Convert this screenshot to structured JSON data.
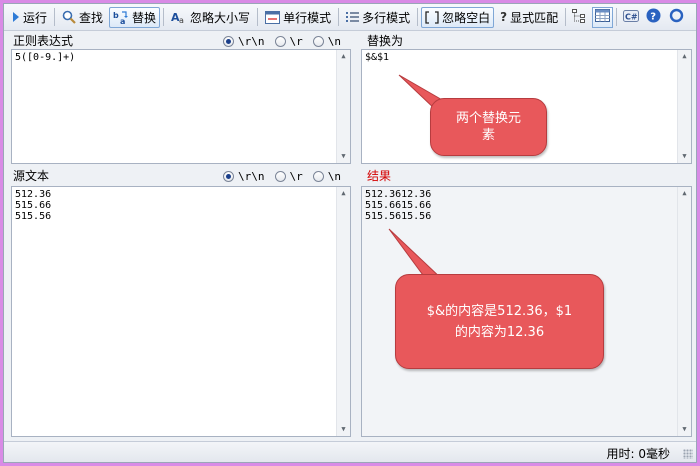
{
  "toolbar": {
    "run_label": "运行",
    "find_label": "查找",
    "replace_label": "替换",
    "ignore_case_label": "忽略大小写",
    "single_line_label": "单行模式",
    "multi_line_label": "多行模式",
    "ignore_space_label": "忽略空白",
    "explicit_capture_label": "显式匹配",
    "explicit_capture_mark": "?"
  },
  "regex_panel": {
    "label": "正则表达式",
    "value": "5([0-9.]+)",
    "newline_options": [
      "\\r\\n",
      "\\r",
      "\\n"
    ],
    "selected": 0
  },
  "replace_panel": {
    "label": "替换为",
    "value": "$&$1"
  },
  "source_panel": {
    "label": "源文本",
    "lines": [
      "512.36",
      "515.66",
      "515.56"
    ],
    "newline_options": [
      "\\r\\n",
      "\\r",
      "\\n"
    ],
    "selected": 0
  },
  "result_panel": {
    "label": "结果",
    "lines": [
      "512.3612.36",
      "515.6615.66",
      "515.5615.56"
    ]
  },
  "callouts": {
    "top": [
      "两个替换元",
      "素"
    ],
    "bottom": [
      "$&的内容是512.36，$1",
      "的内容为12.36"
    ]
  },
  "status": {
    "elapsed": "用时: 0毫秒"
  },
  "colors": {
    "accent_red": "#d40000",
    "callout_fill": "#e8585b"
  }
}
